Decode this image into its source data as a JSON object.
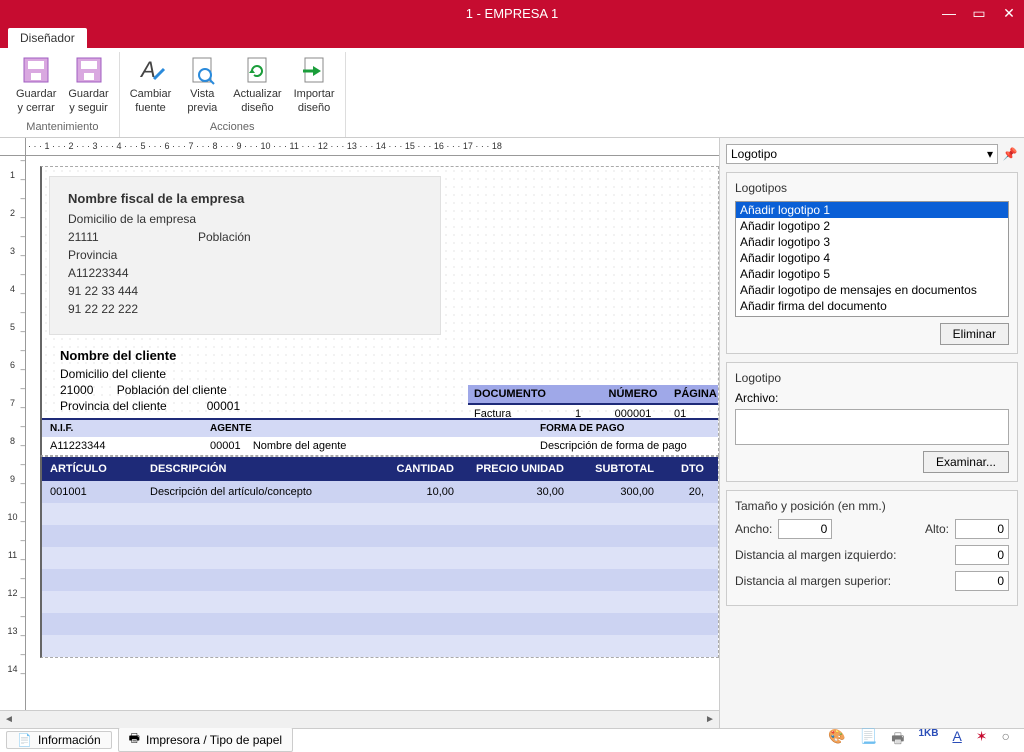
{
  "window": {
    "title": "1 - EMPRESA 1"
  },
  "tabs": {
    "designer": "Diseñador"
  },
  "ribbon": {
    "save_close_l1": "Guardar",
    "save_close_l2": "y cerrar",
    "save_cont_l1": "Guardar",
    "save_cont_l2": "y seguir",
    "font_l1": "Cambiar",
    "font_l2": "fuente",
    "preview_l1": "Vista",
    "preview_l2": "previa",
    "refresh_l1": "Actualizar",
    "refresh_l2": "diseño",
    "import_l1": "Importar",
    "import_l2": "diseño",
    "group_maint": "Mantenimiento",
    "group_actions": "Acciones"
  },
  "hruler": "· · · 1 · · · 2 · · · 3 · · · 4 · · · 5 · · · 6 · · · 7 · · · 8 · · · 9 · · · 10 · · · 11 · · · 12 · · · 13 · · · 14 · · · 15 · · · 16 · · · 17 · · · 18",
  "vruler": [
    "1",
    "2",
    "3",
    "4",
    "5",
    "6",
    "7",
    "8",
    "9",
    "10",
    "11",
    "12",
    "13",
    "14"
  ],
  "company": {
    "name": "Nombre fiscal de la empresa",
    "addr": "Domicilio de la empresa",
    "zip": "21111",
    "city": "Población",
    "province": "Provincia",
    "cif": "A11223344",
    "phone1": "91 22 33 444",
    "phone2": "91 22 22 222"
  },
  "client": {
    "name": "Nombre del cliente",
    "addr": "Domicilio del cliente",
    "zip": "21000",
    "city": "Población del cliente",
    "province": "Provincia del cliente",
    "code": "00001"
  },
  "dochdr": {
    "col_doc": "DOCUMENTO",
    "col_num": "NÚMERO",
    "col_page": "PÁGINA",
    "v_doc": "Factura",
    "v_ser": "1",
    "v_num": "000001",
    "v_page": "01"
  },
  "info_hdr": {
    "nif": "N.I.F.",
    "agente": "AGENTE",
    "forma": "FORMA DE PAGO"
  },
  "info_val": {
    "nif": "A11223344",
    "agcode": "00001",
    "agname": "Nombre del agente",
    "forma": "Descripción de forma de pago"
  },
  "art_hdr": {
    "art": "ARTÍCULO",
    "desc": "DESCRIPCIÓN",
    "cant": "CANTIDAD",
    "precio": "PRECIO UNIDAD",
    "subtotal": "SUBTOTAL",
    "dto": "DTO"
  },
  "art_row": {
    "code": "001001",
    "desc": "Descripción del artículo/concepto",
    "cant": "10,00",
    "precio": "30,00",
    "subtotal": "300,00",
    "dto": "20,"
  },
  "side": {
    "combo": "Logotipo",
    "logos_title": "Logotipos",
    "items": [
      "Añadir logotipo 1",
      "Añadir logotipo 2",
      "Añadir logotipo 3",
      "Añadir logotipo 4",
      "Añadir logotipo 5",
      "Añadir logotipo de mensajes en documentos",
      "Añadir firma del documento"
    ],
    "btn_delete": "Eliminar",
    "logo_title": "Logotipo",
    "file_label": "Archivo:",
    "btn_browse": "Examinar...",
    "size_title": "Tamaño y posición (en mm.)",
    "lbl_ancho": "Ancho:",
    "lbl_alto": "Alto:",
    "lbl_left": "Distancia al margen izquierdo:",
    "lbl_top": "Distancia al margen superior:",
    "val_ancho": "0",
    "val_alto": "0",
    "val_left": "0",
    "val_top": "0"
  },
  "status": {
    "info": "Información",
    "printer": "Impresora / Tipo de papel"
  }
}
